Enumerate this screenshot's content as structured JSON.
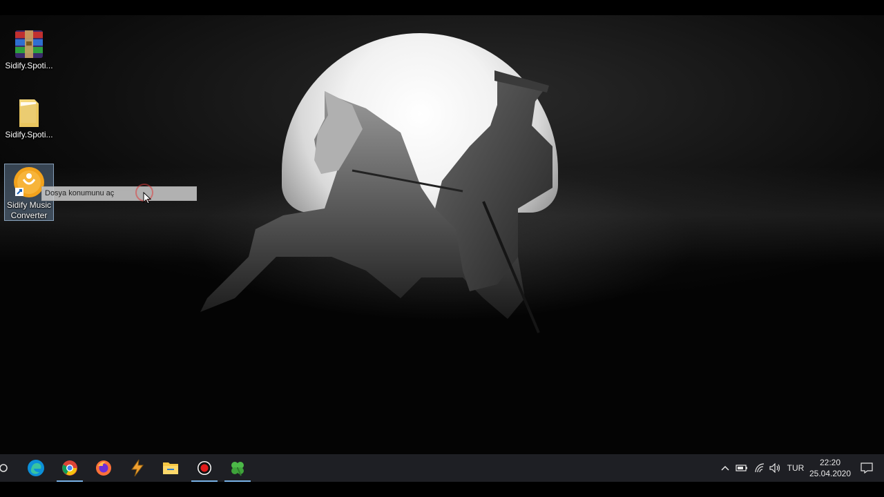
{
  "desktop_icons": [
    {
      "label": "Sidify.Spoti...",
      "icon": "winrar-archive-icon"
    },
    {
      "label": "Sidify.Spoti...",
      "icon": "folder-icon"
    },
    {
      "label": "Sidify Music Converter",
      "icon": "sidify-app-icon",
      "shortcut": true,
      "selected": true
    }
  ],
  "tooltip": {
    "text": "Dosya konumunu aç"
  },
  "taskbar": {
    "apps": [
      {
        "name": "search",
        "icon": "search-circle-icon"
      },
      {
        "name": "edge",
        "icon": "edge-icon"
      },
      {
        "name": "chrome",
        "icon": "chrome-icon",
        "active": true
      },
      {
        "name": "firefox",
        "icon": "firefox-icon"
      },
      {
        "name": "thunder",
        "icon": "lightning-icon"
      },
      {
        "name": "explorer",
        "icon": "file-explorer-icon"
      },
      {
        "name": "recorder",
        "icon": "record-icon",
        "active": true
      },
      {
        "name": "clover",
        "icon": "clover-icon",
        "active": true
      }
    ],
    "tray": {
      "language": "TUR",
      "time": "22:20",
      "date": "25.04.2020"
    }
  },
  "colors": {
    "taskbar_bg": "#1e1f24",
    "accent_underline": "#7ab3e8"
  }
}
